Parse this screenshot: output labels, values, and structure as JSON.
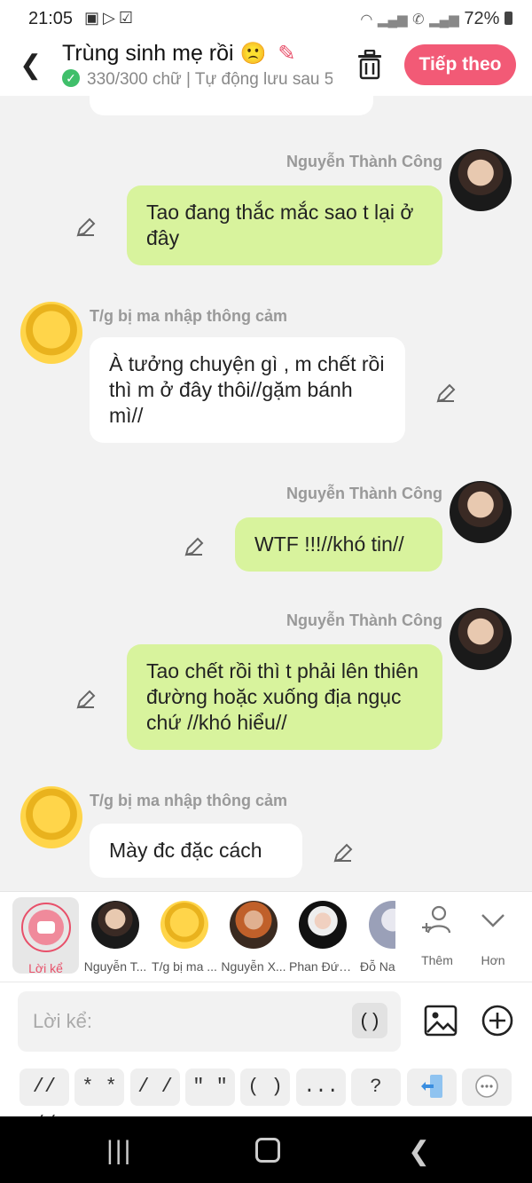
{
  "status_bar": {
    "time": "21:05",
    "left_icons": [
      "image-icon",
      "play-store-icon",
      "checkbox-icon"
    ],
    "right_icons": [
      "wifi-icon",
      "signal-icon",
      "call-signal-icon",
      "signal-icon"
    ],
    "battery": "72%"
  },
  "header": {
    "title": "Trùng sinh mẹ rồi",
    "title_emoji": "🙁",
    "subtitle": "330/300 chữ | Tự động lưu sau 5",
    "next_label": "Tiếp theo"
  },
  "chat": {
    "messages": [
      {
        "side": "right",
        "sender": "Nguyễn Thành Công",
        "text": "Tao đang thắc mắc sao t lại ở đây"
      },
      {
        "side": "left",
        "sender": "T/g bị ma nhập thông cảm",
        "text": "À tưởng chuyện gì , m chết rồi thì m ở đây thôi//gặm bánh mì//"
      },
      {
        "side": "right",
        "sender": "Nguyễn Thành Công",
        "text": "WTF !!!//khó tin//"
      },
      {
        "side": "right",
        "sender": "Nguyễn Thành Công",
        "text": "Tao chết rồi thì t phải lên thiên đường hoặc xuống địa ngục chứ //khó hiểu//"
      },
      {
        "side": "left",
        "sender": "T/g bị ma nhập thông cảm",
        "text": "Mày đc đặc cách"
      }
    ]
  },
  "characters": {
    "narrator_label": "Lời kể",
    "items": [
      {
        "label": "Nguyễn T..."
      },
      {
        "label": "T/g bị ma ..."
      },
      {
        "label": "Nguyễn X..."
      },
      {
        "label": "Phan Đức ..."
      },
      {
        "label": "Đỗ Na"
      }
    ],
    "add_label": "Thêm",
    "more_label": "Hơn"
  },
  "composer": {
    "placeholder": "Lời kể:",
    "paren_button": "( )"
  },
  "quick_chips": [
    "// //",
    "* *",
    "/ /",
    "\" \"",
    "( )",
    "...",
    "?"
  ],
  "colors": {
    "accent": "#f25a76",
    "my_bubble": "#d8f39d",
    "other_bubble": "#ffffff",
    "background": "#f2f2f2"
  }
}
